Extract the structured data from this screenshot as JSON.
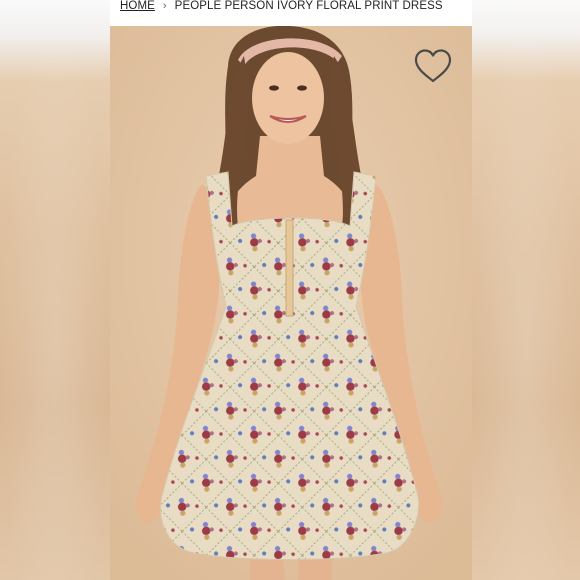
{
  "breadcrumb": {
    "home_label": "HOME",
    "separator": "›",
    "current_label": "PEOPLE PERSON IVORY FLORAL PRINT DRESS"
  },
  "product_image": {
    "alt": "PEOPLE PERSON IVORY FLORAL PRINT DRESS"
  },
  "wishlist": {
    "icon": "heart-outline-icon"
  },
  "colors": {
    "background_beige": "#e3c4a3",
    "dress_ivory": "#e8dcc4",
    "text": "#222222"
  }
}
